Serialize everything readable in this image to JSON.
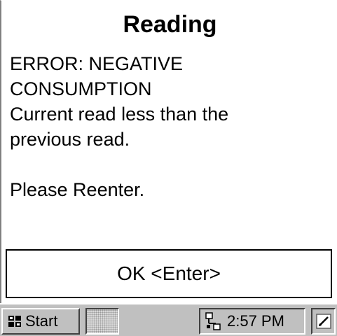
{
  "dialog": {
    "title": "Reading",
    "message_lines": [
      "ERROR:  NEGATIVE",
      "CONSUMPTION",
      "Current read less than the",
      "previous read."
    ],
    "prompt": "Please Reenter.",
    "ok_label": "OK <Enter>"
  },
  "taskbar": {
    "start_label": "Start",
    "start_icon": "windows-flag-icon",
    "clock": "2:57 PM",
    "network_icon": "network-icon",
    "pen_icon": "pen-input-icon"
  }
}
